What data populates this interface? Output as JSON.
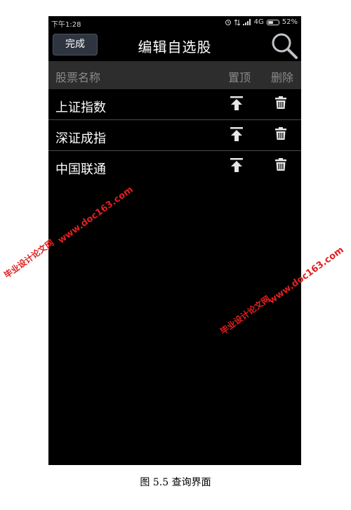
{
  "status_bar": {
    "time": "下午1:28",
    "network": "4G",
    "battery": "52%",
    "battery_level": 0.52
  },
  "navbar": {
    "done_label": "完成",
    "title": "编辑自选股",
    "search_icon": "search-icon"
  },
  "table_header": {
    "name": "股票名称",
    "pin_top": "置顶",
    "delete": "删除"
  },
  "stocks": [
    {
      "name": "上证指数"
    },
    {
      "name": "深证成指"
    },
    {
      "name": "中国联通"
    }
  ],
  "watermarks": {
    "site": "www.doc163.com",
    "cn": "毕业设计论文网"
  },
  "caption": "图 5.5 查询界面",
  "colors": {
    "background": "#000000",
    "header_bg": "#2d2d2d",
    "button_bg": "#2f3540",
    "watermark": "#e02020"
  }
}
